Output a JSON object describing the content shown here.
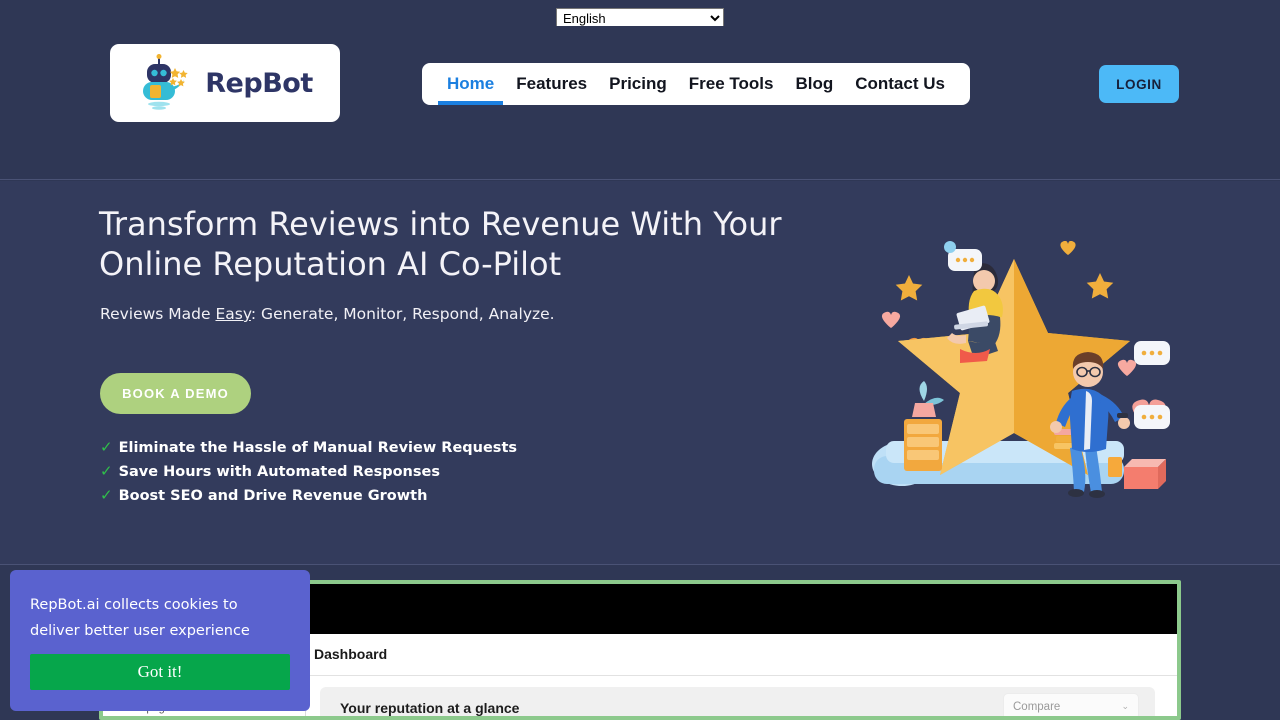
{
  "language_bar": {
    "selected": "English",
    "options": [
      "English"
    ]
  },
  "header": {
    "logo": {
      "name": "RepBot",
      "icon": "robot-with-stars-icon"
    },
    "nav": [
      {
        "label": "Home",
        "active": true
      },
      {
        "label": "Features",
        "active": false
      },
      {
        "label": "Pricing",
        "active": false
      },
      {
        "label": "Free Tools",
        "active": false
      },
      {
        "label": "Blog",
        "active": false
      },
      {
        "label": "Contact Us",
        "active": false
      }
    ],
    "login_label": "LOGIN",
    "colors": {
      "background": "#2f3755",
      "nav_pill": "#ffffff",
      "active_link": "#1b7fe0",
      "login_button": "#4cb9f7"
    }
  },
  "hero": {
    "title_line1": "Transform Reviews into Revenue With Your",
    "title_line2": "Online Reputation AI Co-Pilot",
    "subtitle_prefix": "Reviews Made ",
    "subtitle_emphasis": "Easy",
    "subtitle_suffix": ": Generate, Monitor, Respond, Analyze.",
    "cta_label": "BOOK A DEMO",
    "cta_color": "#aed17f",
    "bullets": [
      "Eliminate the Hassle of Manual Review Requests",
      "Save Hours with Automated Responses",
      "Boost SEO and Drive Revenue Growth"
    ],
    "bullet_marker": "check-mark-icon",
    "bullet_marker_glyph": "✓",
    "bullet_marker_color": "#2fbf4a",
    "illustration": "3d-star-with-people-illustration",
    "background": "#333b5c"
  },
  "dashboard_preview": {
    "frame_color": "#8cc98c",
    "page_title": "Dashboard",
    "card_title": "Your reputation at a glance",
    "compare_placeholder": "Compare",
    "compare_caret": "⌄",
    "sidebar_item": "Homepage"
  },
  "cookie_banner": {
    "message_line1": "RepBot.ai collects cookies to",
    "message_line2": "deliver better user experience",
    "accept_label": "Got it!",
    "background": "#5a62cf",
    "accept_color": "#06a64b"
  }
}
